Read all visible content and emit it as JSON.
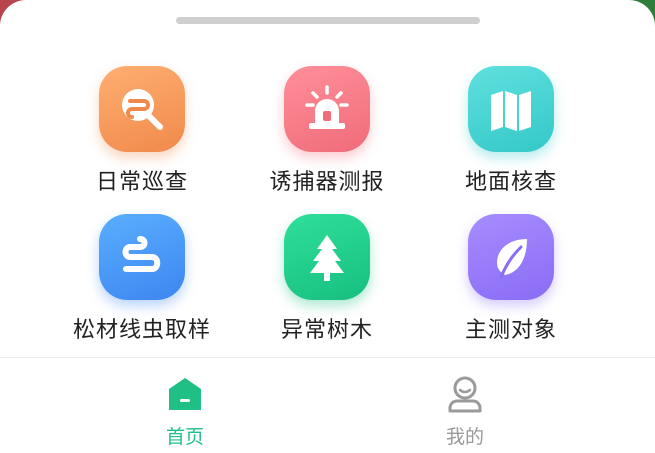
{
  "grid": {
    "items": [
      {
        "label": "日常巡查",
        "icon": "search-icon",
        "color": "#f5914f"
      },
      {
        "label": "诱捕器测报",
        "icon": "alarm-light-icon",
        "color": "#f27683"
      },
      {
        "label": "地面核查",
        "icon": "map-icon",
        "color": "#3dcfcf"
      },
      {
        "label": "松材线虫取样",
        "icon": "worm-icon",
        "color": "#4593f5"
      },
      {
        "label": "异常树木",
        "icon": "pine-tree-icon",
        "color": "#1fc886"
      },
      {
        "label": "主测对象",
        "icon": "leaf-icon",
        "color": "#9275f7"
      }
    ]
  },
  "tabbar": {
    "home_label": "首页",
    "mine_label": "我的",
    "active_color": "#1fbf86",
    "inactive_color": "#999999"
  }
}
